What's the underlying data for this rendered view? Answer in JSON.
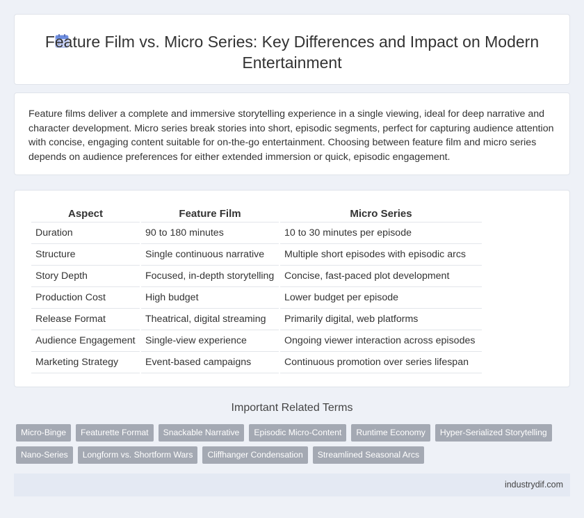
{
  "header": {
    "icon": "calendar-icon",
    "title": "Feature Film vs. Micro Series: Key Differences and Impact on Modern Entertainment"
  },
  "intro": "Feature films deliver a complete and immersive storytelling experience in a single viewing, ideal for deep narrative and character development. Micro series break stories into short, episodic segments, perfect for capturing audience attention with concise, engaging content suitable for on-the-go entertainment. Choosing between feature film and micro series depends on audience preferences for either extended immersion or quick, episodic engagement.",
  "table": {
    "headers": [
      "Aspect",
      "Feature Film",
      "Micro Series"
    ],
    "rows": [
      [
        "Duration",
        "90 to 180 minutes",
        "10 to 30 minutes per episode"
      ],
      [
        "Structure",
        "Single continuous narrative",
        "Multiple short episodes with episodic arcs"
      ],
      [
        "Story Depth",
        "Focused, in-depth storytelling",
        "Concise, fast-paced plot development"
      ],
      [
        "Production Cost",
        "High budget",
        "Lower budget per episode"
      ],
      [
        "Release Format",
        "Theatrical, digital streaming",
        "Primarily digital, web platforms"
      ],
      [
        "Audience Engagement",
        "Single-view experience",
        "Ongoing viewer interaction across episodes"
      ],
      [
        "Marketing Strategy",
        "Event-based campaigns",
        "Continuous promotion over series lifespan"
      ]
    ]
  },
  "related": {
    "heading": "Important Related Terms",
    "tags": [
      "Micro-Binge",
      "Featurette Format",
      "Snackable Narrative",
      "Episodic Micro-Content",
      "Runtime Economy",
      "Hyper-Serialized Storytelling",
      "Nano-Series",
      "Longform vs. Shortform Wars",
      "Cliffhanger Condensation",
      "Streamlined Seasonal Arcs"
    ]
  },
  "footer": {
    "site": "industrydif.com"
  },
  "colors": {
    "page_bg": "#eef1f7",
    "tag_bg": "#a4a9b3",
    "footer_bg": "#e4e9f3",
    "icon_accent": "#6c8de0"
  }
}
